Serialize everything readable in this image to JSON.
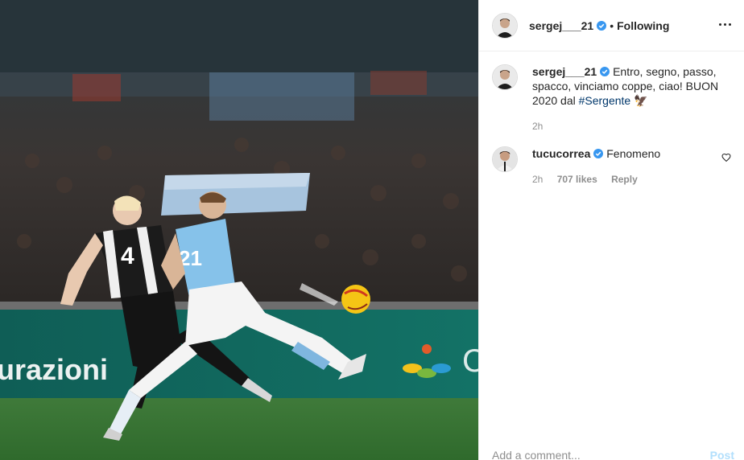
{
  "post": {
    "author": "sergej___21",
    "follow_separator": "•",
    "follow_status": "Following"
  },
  "caption": {
    "user": "sergej___21",
    "text": "Entro, segno, passo, spacco, vinciamo coppe, ciao! BUON 2020 dal",
    "hashtag": "#Sergente",
    "emoji": "🦅",
    "time": "2h"
  },
  "comments": [
    {
      "user": "tucucorrea",
      "text": "Fenomeno",
      "time": "2h",
      "likes": "707 likes",
      "reply": "Reply"
    }
  ],
  "composer": {
    "placeholder": "Add a comment...",
    "post_label": "Post"
  },
  "media": {
    "banner_text": "urazioni",
    "players": [
      {
        "team": "Juventus",
        "number": "4"
      },
      {
        "team": "Lazio",
        "number": "21"
      }
    ]
  },
  "colors": {
    "verified": "#3897f0",
    "link": "#00376b",
    "muted": "#8e8e8e",
    "post_disabled": "#b2dffc"
  }
}
